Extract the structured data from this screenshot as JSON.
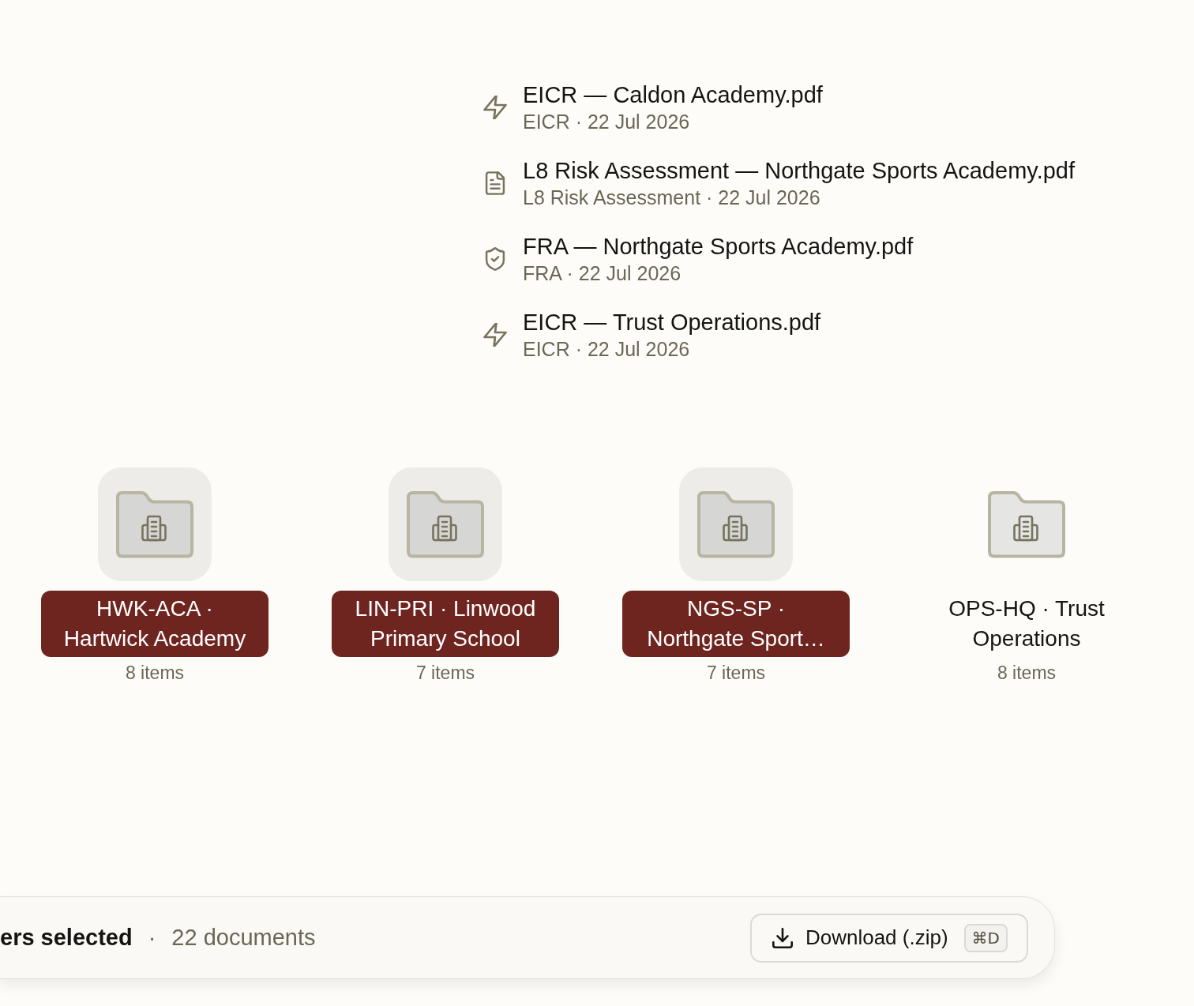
{
  "documents": [
    {
      "kind": "lightning",
      "title": "EICR — Caldon Academy.pdf",
      "meta": "EICR · 22 Jul 2026"
    },
    {
      "kind": "document",
      "title": "L8 Risk Assessment — Northgate Sports Academy.pdf",
      "meta": "L8 Risk Assessment · 22 Jul 2026"
    },
    {
      "kind": "shield",
      "title": "FRA — Northgate Sports Academy.pdf",
      "meta": "FRA · 22 Jul 2026"
    },
    {
      "kind": "lightning",
      "title": "EICR — Trust Operations.pdf",
      "meta": "EICR · 22 Jul 2026"
    }
  ],
  "folders": [
    {
      "label": "HWK-ACA · Hartwick Academy",
      "count": "8 items",
      "selected": true
    },
    {
      "label": "LIN-PRI · Linwood Primary School",
      "count": "7 items",
      "selected": true
    },
    {
      "label": "NGS-SP · Northgate Sport…",
      "count": "7 items",
      "selected": true
    },
    {
      "label": "OPS-HQ · Trust Operations",
      "count": "8 items",
      "selected": false
    }
  ],
  "selection_bar": {
    "summary": "ers selected",
    "separator": "·",
    "document_count": "22 documents",
    "download_button": {
      "label": "Download (.zip)",
      "shortcut": "⌘D"
    }
  }
}
